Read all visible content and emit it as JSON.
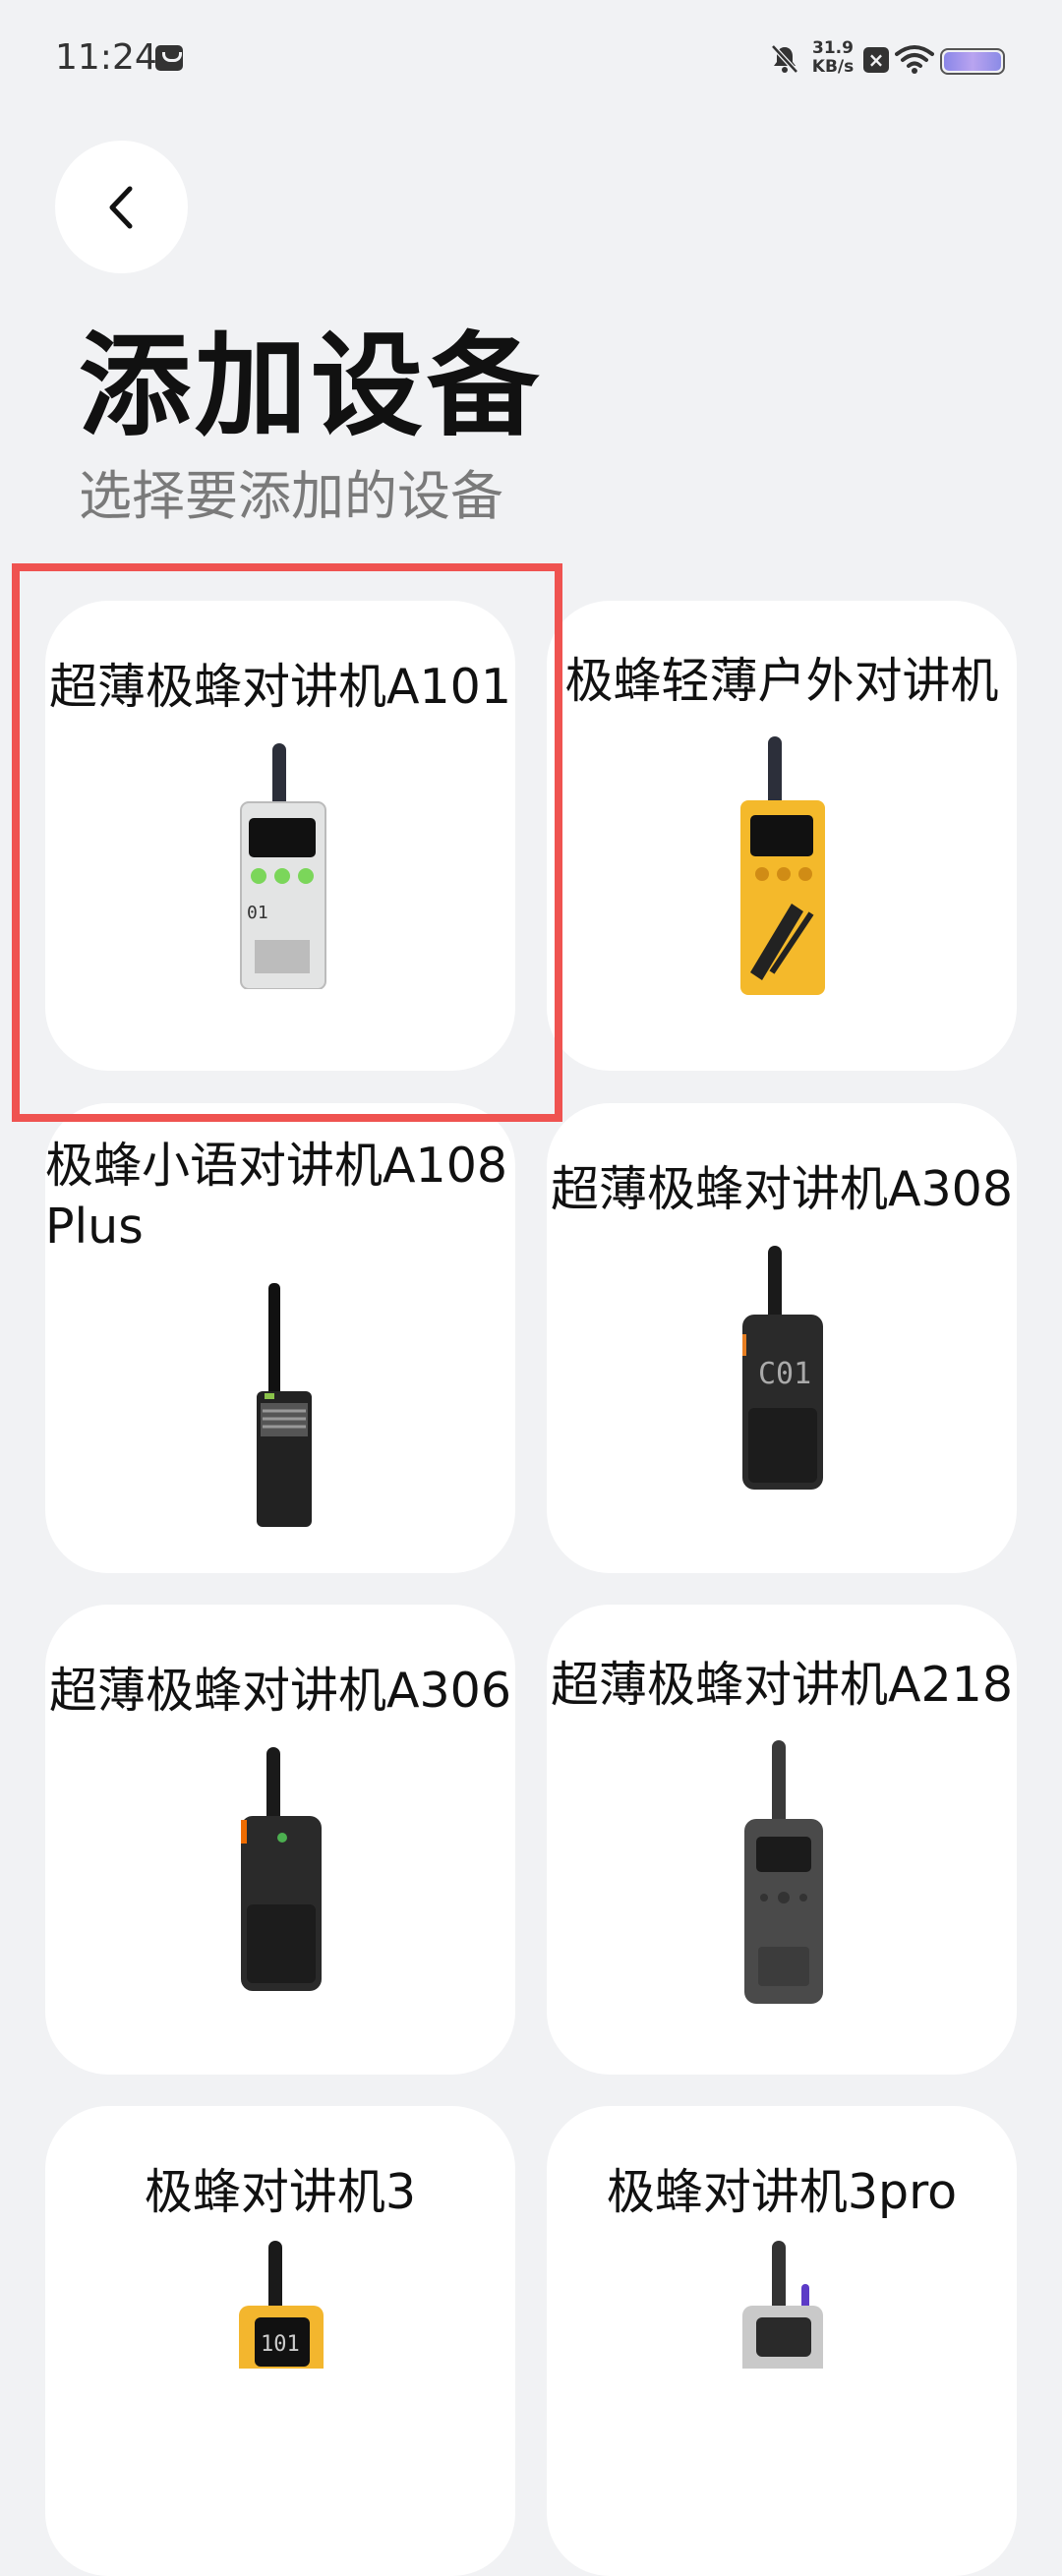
{
  "status_bar": {
    "time": "11:24",
    "net_speed_value": "31.9",
    "net_speed_unit": "KB/s",
    "x_badge": "×"
  },
  "header": {
    "title": "添加设备",
    "subtitle": "选择要添加的设备"
  },
  "devices": [
    {
      "name": "超薄极蜂对讲机A101",
      "icon": "walkie-talkie-white-icon",
      "screen_text": "01"
    },
    {
      "name": "极蜂轻薄户外对讲机",
      "icon": "walkie-talkie-yellow-icon"
    },
    {
      "name": "极蜂小语对讲机A108 Plus",
      "icon": "walkie-talkie-handheld-icon"
    },
    {
      "name": "超薄极蜂对讲机A308",
      "icon": "walkie-talkie-black-icon",
      "screen_text": "C01"
    },
    {
      "name": "超薄极蜂对讲机A306",
      "icon": "walkie-talkie-black-orange-icon"
    },
    {
      "name": "超薄极蜂对讲机A218",
      "icon": "walkie-talkie-gray-icon"
    },
    {
      "name": "极蜂对讲机3",
      "icon": "walkie-talkie-yellow-black-icon",
      "screen_text": "101"
    },
    {
      "name": "极蜂对讲机3pro",
      "icon": "walkie-talkie-silver-icon"
    }
  ],
  "colors": {
    "background": "#f1f2f4",
    "card": "#ffffff",
    "highlight": "#ef5350"
  }
}
